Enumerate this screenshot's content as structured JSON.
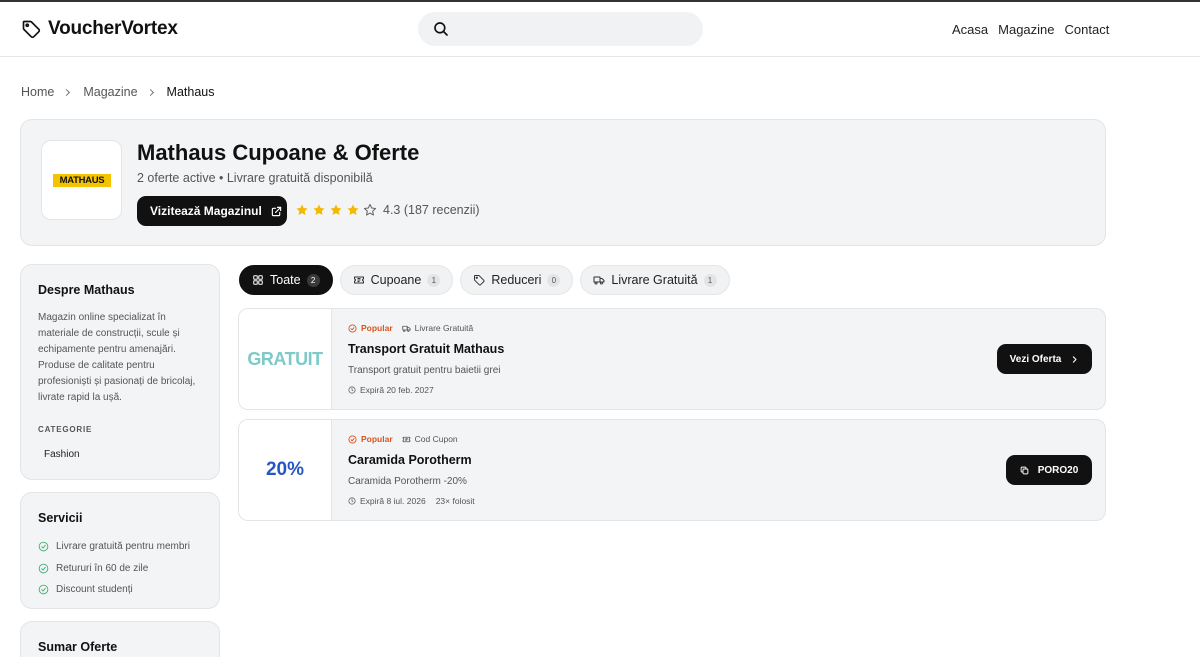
{
  "brand": {
    "name": "VoucherVortex"
  },
  "search": {
    "placeholder": ""
  },
  "nav": {
    "items": [
      "Acasa",
      "Magazine",
      "Contact"
    ]
  },
  "breadcrumb": [
    "Home",
    "Magazine",
    "Mathaus"
  ],
  "store": {
    "logo_text": "MATHAUS",
    "title": "Mathaus Cupoane & Oferte",
    "subtitle": "2 oferte active • Livrare gratuită disponibilă",
    "visit_label": "Vizitează Magazinul",
    "rating": 4.3,
    "rating_text": "4.3 (187 recenzii)",
    "star_color": "#f5b800"
  },
  "about": {
    "title": "Despre Mathaus",
    "description": "Magazin online specializat în materiale de construcții, scule și echipamente pentru amenajări. Produse de calitate pentru profesioniști și pasionați de bricolaj, livrate rapid la ușă.",
    "category_heading": "CATEGORIE",
    "category": "Fashion"
  },
  "services": {
    "title": "Servicii",
    "items": [
      "Livrare gratuită pentru membri",
      "Retururi în 60 de zile",
      "Discount studenți"
    ]
  },
  "summary": {
    "title": "Sumar Oferte"
  },
  "tabs": [
    {
      "label": "Toate",
      "count": "2",
      "icon": "grid-icon",
      "active": true
    },
    {
      "label": "Cupoane",
      "count": "1",
      "icon": "ticket-icon",
      "active": false
    },
    {
      "label": "Reduceri",
      "count": "0",
      "icon": "tag-icon",
      "active": false
    },
    {
      "label": "Livrare Gratuită",
      "count": "1",
      "icon": "truck-icon",
      "active": false
    }
  ],
  "offers": [
    {
      "badge": "GRATUIT",
      "popular": "Popular",
      "type": "Livrare Gratuită",
      "title": "Transport Gratuit Mathaus",
      "description": "Transport gratuit pentru baietii grei",
      "expires": "Expiră 20 feb. 2027",
      "used": "",
      "cta": "Vezi Oferta"
    },
    {
      "badge": "20%",
      "popular": "Popular",
      "type": "Cod Cupon",
      "title": "Caramida Porotherm",
      "description": "Caramida Porotherm -20%",
      "expires": "Expiră 8 iul. 2026",
      "used": "23× folosit",
      "cta": "PORO20"
    }
  ]
}
